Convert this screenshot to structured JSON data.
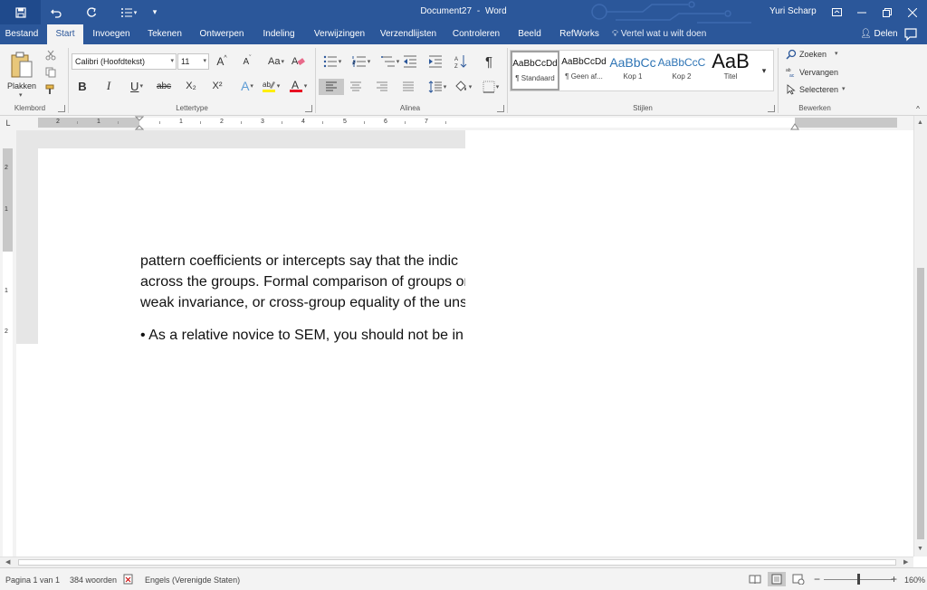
{
  "titlebar": {
    "document": "Document27",
    "separator": "-",
    "app": "Word",
    "user": "Yuri Scharp",
    "bg_color": "#2b579a"
  },
  "quick_access": {
    "save_icon": "save-icon",
    "undo_icon": "undo-icon",
    "redo_icon": "redo-icon",
    "list_icon": "bullet-list-icon"
  },
  "tabs": [
    {
      "label": "Bestand"
    },
    {
      "label": "Start"
    },
    {
      "label": "Invoegen"
    },
    {
      "label": "Tekenen"
    },
    {
      "label": "Ontwerpen"
    },
    {
      "label": "Indeling"
    },
    {
      "label": "Verwijzingen"
    },
    {
      "label": "Verzendlijsten"
    },
    {
      "label": "Controleren"
    },
    {
      "label": "Beeld"
    },
    {
      "label": "RefWorks"
    }
  ],
  "active_tab": "Start",
  "tell_me": "Vertel wat u wilt doen",
  "share": "Delen",
  "ribbon": {
    "clipboard": {
      "paste": "Plakken",
      "group": "Klembord"
    },
    "font": {
      "name": "Calibri (Hoofdtekst)",
      "size": "11",
      "group": "Lettertype",
      "bold": "B",
      "italic": "I",
      "underline": "U",
      "strike": "abc",
      "sub": "X₂",
      "sup": "X²",
      "grow": "A",
      "shrink": "A",
      "case": "Aa",
      "color": "A"
    },
    "paragraph": {
      "group": "Alinea",
      "pilcrow": "¶"
    },
    "styles": {
      "group": "Stijlen",
      "items": [
        {
          "sample": "AaBbCcDd",
          "name": "¶ Standaard"
        },
        {
          "sample": "AaBbCcDd",
          "name": "¶ Geen af..."
        },
        {
          "sample": "AaBbCc",
          "name": "Kop 1"
        },
        {
          "sample": "AaBbCcC",
          "name": "Kop 2"
        },
        {
          "sample": "AaB",
          "name": "Titel"
        }
      ]
    },
    "editing": {
      "group": "Bewerken",
      "find": "Zoeken",
      "replace": "Vervangen",
      "select": "Selecteren"
    }
  },
  "ruler": {
    "h_numbers": [
      "2",
      "1",
      "1",
      "2",
      "3",
      "4",
      "5",
      "6",
      "7"
    ],
    "v_numbers": [
      "2",
      "1",
      "1",
      "2"
    ],
    "corner": "L"
  },
  "document": {
    "lines": [
      "pattern coefficients or intercepts say that the indic",
      "across the groups. Formal comparison of groups or",
      "weak invariance, or cross-group equality of the uns",
      "• As a relative novice to SEM, you should not be in"
    ]
  },
  "status": {
    "page": "Pagina 1 van 1",
    "words": "384 woorden",
    "language": "Engels (Verenigde Staten)",
    "zoom": "160%",
    "minus": "−",
    "plus": "+"
  }
}
